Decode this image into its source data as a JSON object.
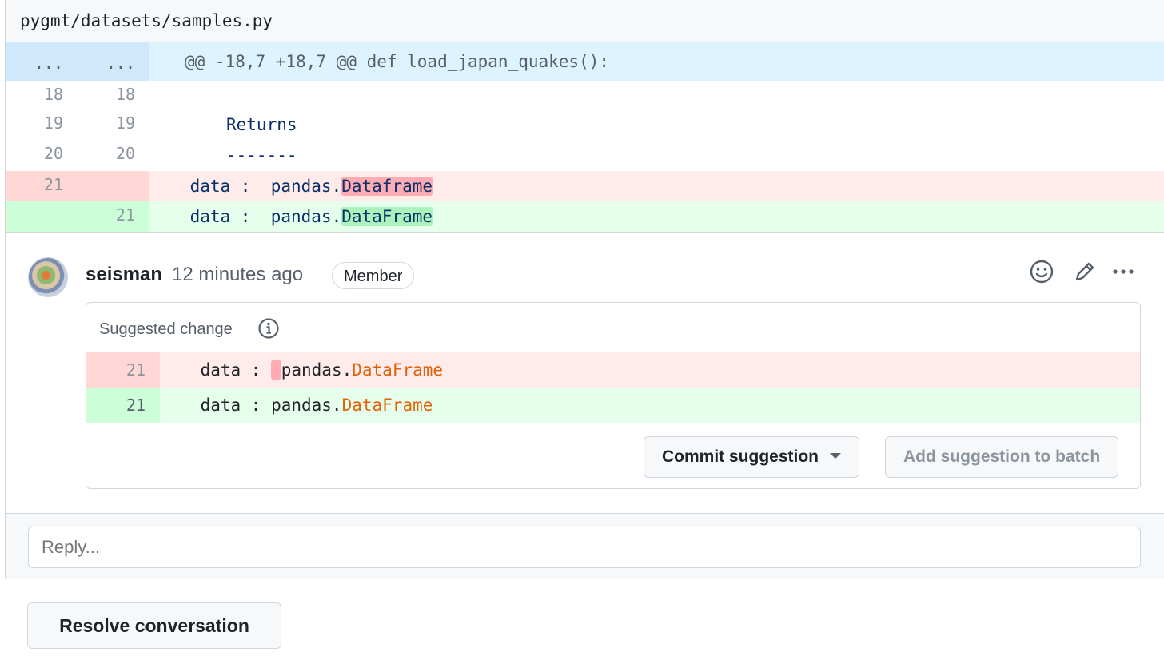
{
  "file": {
    "path": "pygmt/datasets/samples.py"
  },
  "diff": {
    "hunk": {
      "old": "...",
      "new": "...",
      "text": "@@ -18,7 +18,7 @@ def load_japan_quakes():"
    },
    "lines": [
      {
        "old": "18",
        "new": "18",
        "indent": "",
        "text": ""
      },
      {
        "old": "19",
        "new": "19",
        "indent": "    ",
        "text": "Returns"
      },
      {
        "old": "20",
        "new": "20",
        "indent": "    ",
        "text": "-------"
      }
    ],
    "deleted": {
      "old": "21",
      "prefix": "    data :  pandas.",
      "highlight": "Dataframe"
    },
    "added": {
      "new": "21",
      "prefix": "    data :  pandas.",
      "highlight": "DataFrame"
    }
  },
  "comment": {
    "author": "seisman",
    "time": "12 minutes ago",
    "badge": "Member",
    "suggestion": {
      "title": "Suggested change",
      "removed": {
        "num": "21",
        "prefix": "    data : ",
        "space": " ",
        "module": "pandas.",
        "name": "DataFrame"
      },
      "added": {
        "num": "21",
        "prefix": "    data : ",
        "module": "pandas.",
        "name": "DataFrame"
      },
      "commit_label": "Commit suggestion",
      "batch_label": "Add suggestion to batch"
    }
  },
  "reply": {
    "placeholder": "Reply..."
  },
  "resolve_label": "Resolve conversation",
  "icons": {
    "emoji": "smiley-icon",
    "edit": "pencil-icon",
    "more": "kebab-horizontal-icon",
    "info": "info-icon",
    "caret": "triangle-down-icon"
  },
  "colors": {
    "deleted_bg": "#ffebe9",
    "added_bg": "#e6ffec",
    "hunk_bg": "#ddf4ff",
    "token_orange": "#e36209"
  }
}
